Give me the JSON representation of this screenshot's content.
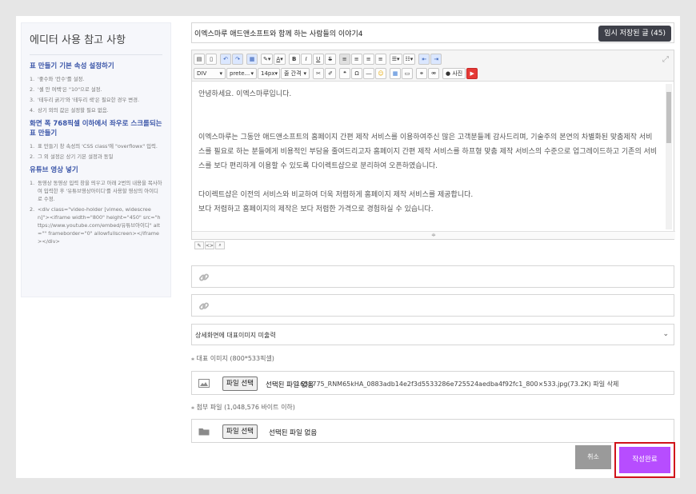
{
  "sidebar": {
    "title": "에디터 사용 참고 사항",
    "sections": [
      {
        "heading": "표 만들기 기본 속성 설정하기",
        "items": [
          "'좋수와 '칸수'를 설정.",
          "'셀 안 여백'은 \"10\"으로 설정.",
          "'테두리 굵기'와 '테두리 색'은 필요한 경우 변경.",
          "상기 외의 값은 설정할 필요 없음."
        ]
      },
      {
        "heading": "화면 폭 768픽셀 이하에서 좌우로 스크롤되는 표 만들기",
        "items": [
          "표 만들기 창 속성의 'CSS class'에 \"overflowx\" 입력.",
          "그 외 설정은 상기 기본 설정과 동일"
        ]
      },
      {
        "heading": "유튜브 영상 넣기",
        "items": [
          "동영상 동영상 입력 창을 띄우고 아래 2번의 내용을 복사하여 입력한 후 '유튜브영상아이디'를 사용할 영상의 아이디로 수정.",
          "<div class=\"video-holder [vimeo, widescreen]\"><iframe width=\"800\" height=\"450\" src=\"https://www.youtube.com/embed/유튜브아이디\" alt=\"\" frameborder=\"0\" allowfullscreen></iframe></div>"
        ]
      }
    ]
  },
  "subject": {
    "value": "이엑스마루 애드앤소프트와 함께 하는 사람들의 이야기4"
  },
  "save_button": "임시 저장된 글 (45)",
  "toolbar": {
    "format": "DIV",
    "style": "prete...",
    "size": "14px",
    "line_height": "줄 간격",
    "photo": "사진",
    "bold": "B",
    "italic": "I",
    "underline": "U",
    "strike": "S",
    "omega": "Ω",
    "quote": "❝"
  },
  "content": {
    "paragraphs": [
      "안녕하세요. 이엑스마루입니다.",
      "",
      "이엑스마루는 그동안 애드앤소프트의 홈페이지 간편 제작 서비스를 이용하여주신 많은 고객분들께 감사드리며, 기술주의 본연의 차별화된 맞춤제작 서비스를 필요로 하는 분들에게 비용적인 부담을 줄여드리고자 홈페이지 간편 제작 서비스를 하프형 맞춤 제작 서비스의 수준으로 업그레이드하고 기존의 서비스를 보다 편리하게 이용할 수 있도록 다이렉트샵으로 분리하여 오픈하였습니다.",
      "",
      "다이렉트샵은 이전의 서비스와 비교하여 더욱 저렴하게 홈페이지 제작 서비스를 제공합니다.",
      "보다 저렴하고 홈페이지의 제작은 보다 저렴한 가격으로 경험하실 수 있습니다."
    ]
  },
  "link1": {
    "value": ""
  },
  "link2": {
    "value": ""
  },
  "select": {
    "value": "상세화면에 대표이미지 미출력"
  },
  "image_label": "대표 이미지 (800*533픽셀)",
  "image_file": {
    "button": "파일 선택",
    "status": "선택된 파일 없음",
    "name": "1631775_RNM65kHA_0883adb14e2f3d5533286e725524aedba4f92fc1_800×533.jpg(73.2K) 파일 삭제"
  },
  "attach_label": "첨부 파일 (1,048,576 바이트 이하)",
  "attach_file": {
    "button": "파일 선택",
    "status": "선택된 파일 없음"
  },
  "cancel_button": "취소",
  "submit_button": "작성완료",
  "colors": {
    "accent": "#b74dff",
    "highlight_border": "#d0121a",
    "dark_button": "#3e4049",
    "heading_blue": "#3a55a8"
  }
}
